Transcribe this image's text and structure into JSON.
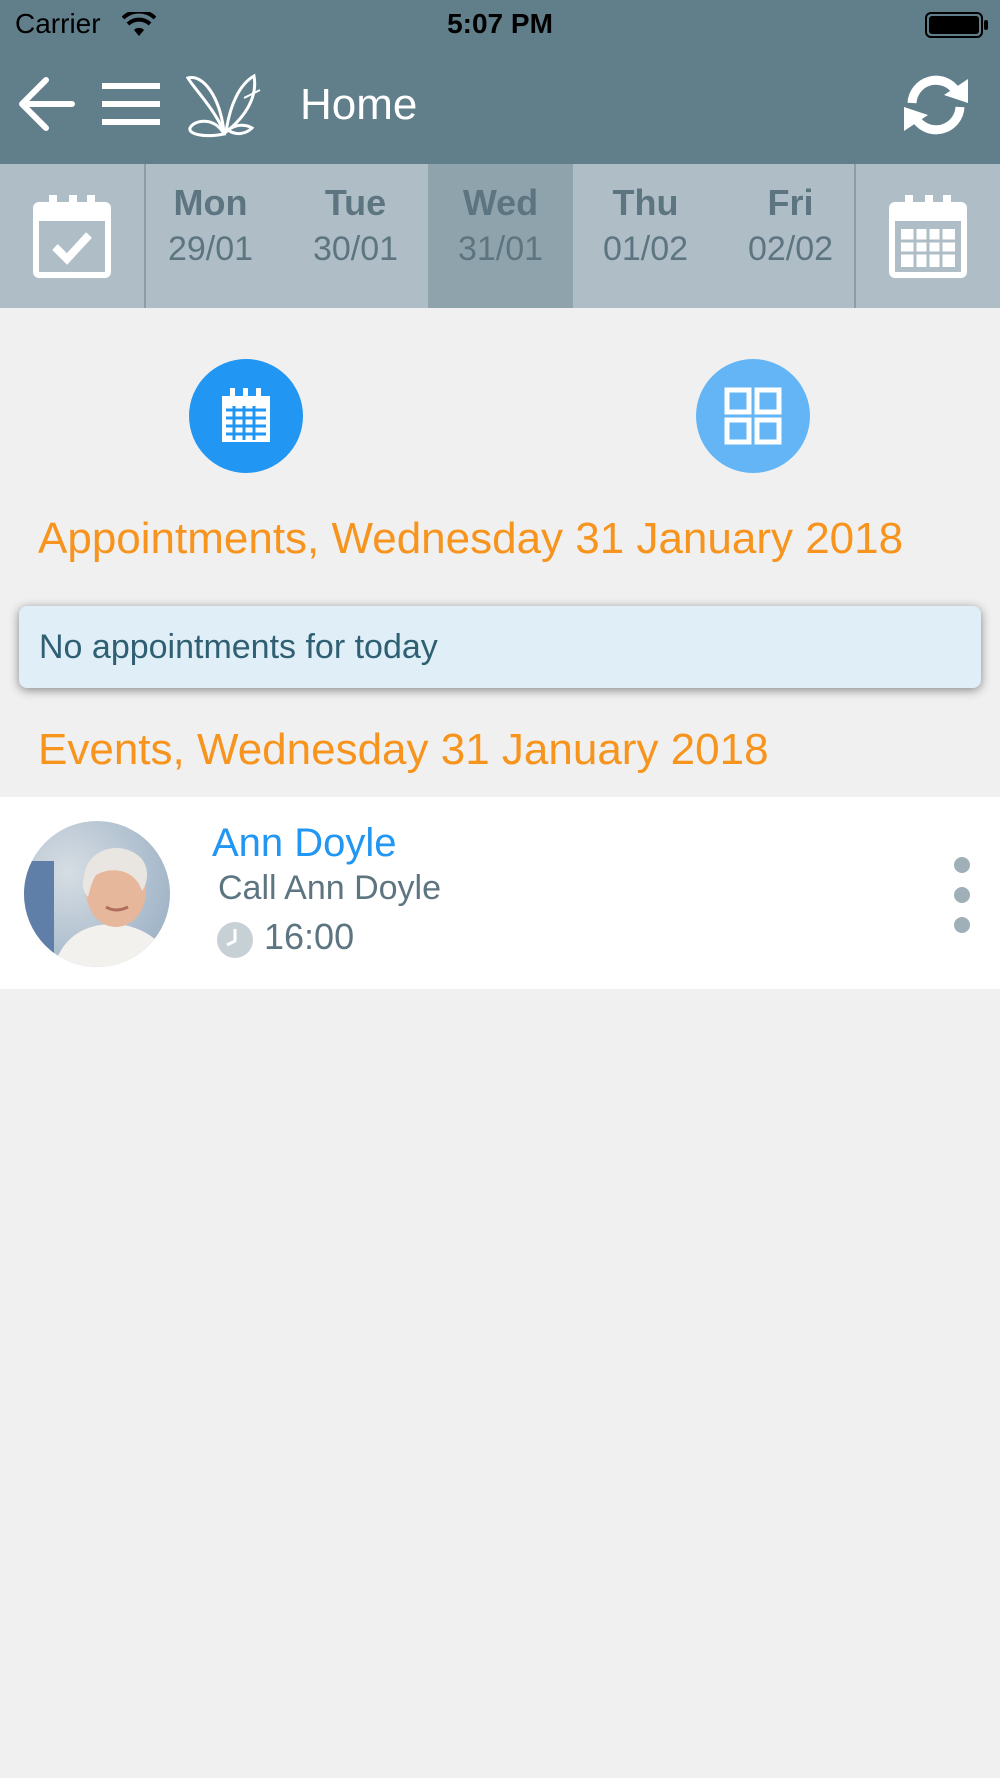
{
  "status_bar": {
    "carrier": "Carrier",
    "time": "5:07 PM"
  },
  "nav": {
    "title": "Home",
    "icons": [
      "back-arrow-icon",
      "hamburger-menu-icon",
      "butterfly-logo-icon",
      "sync-icon"
    ]
  },
  "week": {
    "days": [
      {
        "name": "Mon",
        "date": "29/01"
      },
      {
        "name": "Tue",
        "date": "30/01"
      },
      {
        "name": "Wed",
        "date": "31/01"
      },
      {
        "name": "Thu",
        "date": "01/02"
      },
      {
        "name": "Fri",
        "date": "02/02"
      }
    ],
    "selected_day": "Wed"
  },
  "appointments": {
    "heading": "Appointments, Wednesday 31 January 2018",
    "empty_message": "No appointments for today"
  },
  "events": {
    "heading": "Events, Wednesday 31 January 2018",
    "items": [
      {
        "name": "Ann Doyle",
        "description": "Call Ann Doyle",
        "time": "16:00"
      }
    ]
  },
  "colors": {
    "header": "#617e8b",
    "week_strip": "#afbec6",
    "week_selected": "#8fa3ac",
    "accent_orange": "#f7941d",
    "primary_blue": "#2196f3",
    "light_blue": "#64b5f6",
    "empty_card": "#e0eff7"
  }
}
